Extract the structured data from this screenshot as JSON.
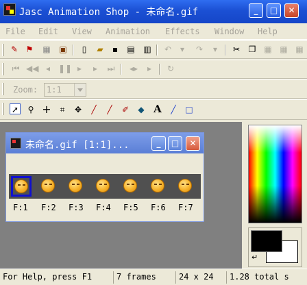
{
  "window": {
    "title": "Jasc Animation Shop - 未命名.gif",
    "buttons": {
      "minimize": "_",
      "maximize": "□",
      "close": "✕"
    }
  },
  "menu": [
    "File",
    "Edit",
    "View",
    "Animation",
    "Effects",
    "Window",
    "Help"
  ],
  "toolbar_main": {
    "icons": [
      "wizard-icon",
      "banner-icon",
      "palette-icon",
      "media-icon",
      "new-icon",
      "open-icon",
      "save-icon",
      "save-frames-icon",
      "print-icon",
      "undo-icon",
      "redo-icon",
      "cut-icon",
      "copy-icon",
      "copy-frame-icon",
      "paste-icon",
      "paste-frame-icon"
    ]
  },
  "toolbar_playback": {
    "icons": [
      "first-frame-icon",
      "prev-frames-icon",
      "prev-frame-icon",
      "pause-icon",
      "next-frame-icon",
      "next-frames-icon",
      "last-frame-icon",
      "crop-frames-icon",
      "loop-icon"
    ]
  },
  "zoom": {
    "label": "Zoom:",
    "value": "1:1"
  },
  "tools": {
    "icons": [
      "arrow-select-icon",
      "zoom-icon",
      "crosshair-icon",
      "crop-icon",
      "move-icon",
      "dropper-icon",
      "paint-brush-icon",
      "eraser-icon",
      "fill-icon",
      "text-icon",
      "line-icon",
      "rectangle-icon"
    ],
    "text_tool_glyph": "A"
  },
  "document": {
    "title": "未命名.gif [1:1]...",
    "buttons": {
      "minimize": "_",
      "maximize": "□",
      "close": "✕"
    },
    "frames": [
      {
        "label": "F:1",
        "selected": true
      },
      {
        "label": "F:2",
        "selected": false
      },
      {
        "label": "F:3",
        "selected": false
      },
      {
        "label": "F:4",
        "selected": false
      },
      {
        "label": "F:5",
        "selected": false
      },
      {
        "label": "F:6",
        "selected": false
      },
      {
        "label": "F:7",
        "selected": false
      }
    ]
  },
  "colors": {
    "foreground": "#000000",
    "background": "#ffffff",
    "workspace": "#808080",
    "title_bar": "#1b50d4"
  },
  "status": {
    "help": "For Help, press F1",
    "frames": "7 frames",
    "size": "24 x 24",
    "time": "1.28 total s"
  }
}
